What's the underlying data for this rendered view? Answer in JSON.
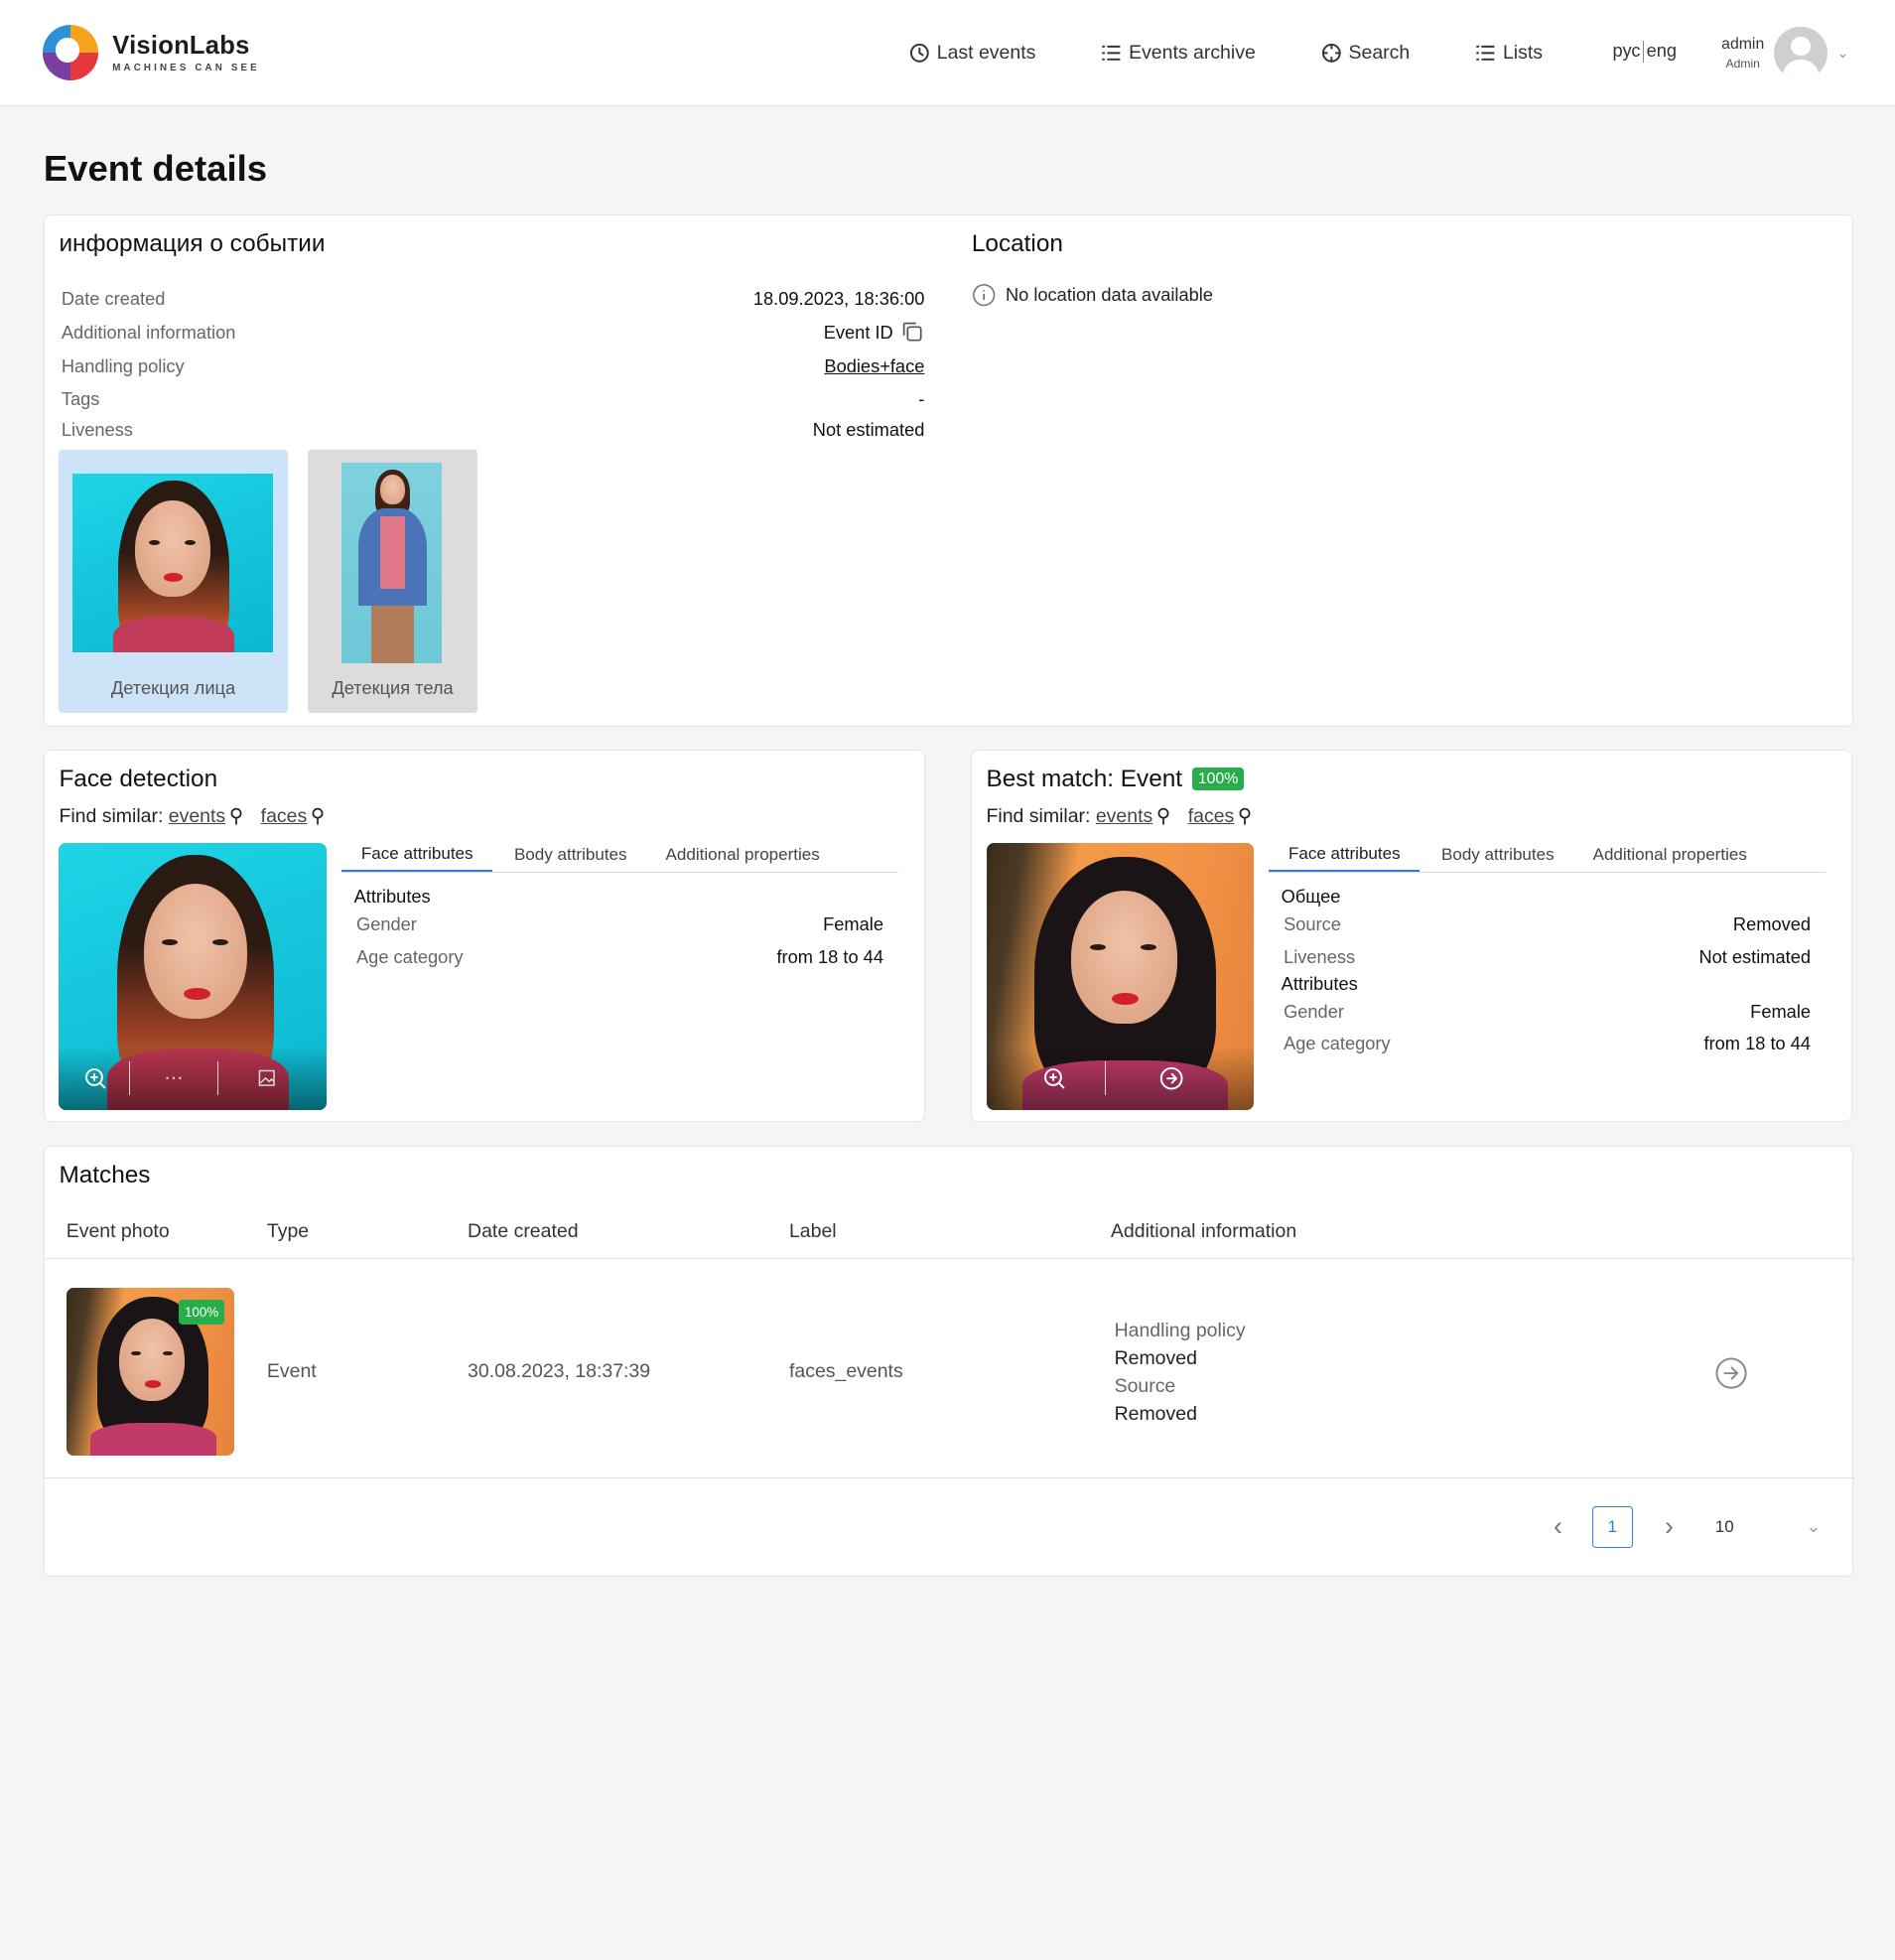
{
  "brand": {
    "name": "VisionLabs",
    "tagline": "MACHINES CAN SEE"
  },
  "nav": [
    {
      "label": "Last events",
      "icon": "clock-icon"
    },
    {
      "label": "Events archive",
      "icon": "list-icon"
    },
    {
      "label": "Search",
      "icon": "crosshair-icon"
    },
    {
      "label": "Lists",
      "icon": "list-icon"
    }
  ],
  "lang": {
    "ru": "рус",
    "en": "eng"
  },
  "user": {
    "name": "admin",
    "role": "Admin"
  },
  "page_title": "Event details",
  "event_info": {
    "title": "информация о событии",
    "rows": [
      {
        "key": "Date created",
        "value": "18.09.2023, 18:36:00"
      },
      {
        "key": "Additional information",
        "value": "Event ID"
      },
      {
        "key": "Handling policy",
        "value": "Bodies+face"
      },
      {
        "key": "Tags",
        "value": "-"
      },
      {
        "key": "Liveness",
        "value": "Not estimated"
      }
    ],
    "thumbs": [
      {
        "caption": "Детекция лица"
      },
      {
        "caption": "Детекция тела"
      }
    ]
  },
  "location": {
    "title": "Location",
    "empty": "No location data available"
  },
  "face_detection": {
    "title": "Face detection",
    "find_similar": "Find similar:",
    "events_link": "events",
    "faces_link": "faces",
    "tabs": [
      "Face attributes",
      "Body attributes",
      "Additional properties"
    ],
    "section": "Attributes",
    "rows": [
      {
        "key": "Gender",
        "value": "Female"
      },
      {
        "key": "Age category",
        "value": "from 18 to 44"
      }
    ]
  },
  "best_match": {
    "title": "Best match: Event",
    "score": "100%",
    "find_similar": "Find similar:",
    "events_link": "events",
    "faces_link": "faces",
    "tabs": [
      "Face attributes",
      "Body attributes",
      "Additional properties"
    ],
    "section1": "Общее",
    "rows1": [
      {
        "key": "Source",
        "value": "Removed"
      },
      {
        "key": "Liveness",
        "value": "Not estimated"
      }
    ],
    "section2": "Attributes",
    "rows2": [
      {
        "key": "Gender",
        "value": "Female"
      },
      {
        "key": "Age category",
        "value": "from 18 to 44"
      }
    ]
  },
  "matches": {
    "title": "Matches",
    "columns": [
      "Event photo",
      "Type",
      "Date created",
      "Label",
      "Additional information"
    ],
    "rows": [
      {
        "score": "100%",
        "type": "Event",
        "date": "30.08.2023, 18:37:39",
        "label": "faces_events",
        "info": [
          {
            "key": "Handling policy",
            "value": "Removed"
          },
          {
            "key": "Source",
            "value": "Removed"
          }
        ]
      }
    ],
    "pagination": {
      "current": "1",
      "page_size": "10"
    }
  },
  "colors": {
    "accent": "#2e7fd1",
    "badge": "#27ae4a",
    "selected_thumb": "#cde3f7"
  }
}
